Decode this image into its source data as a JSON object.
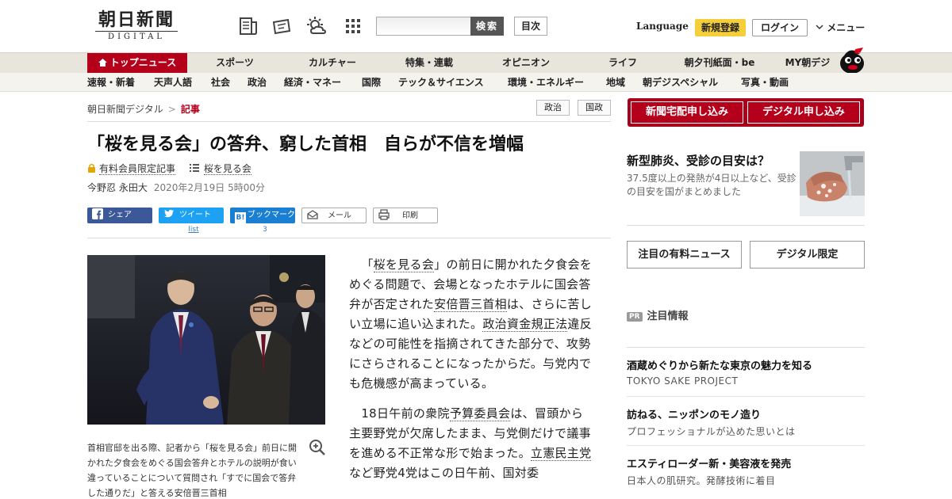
{
  "header": {
    "logo_main": "朝日新聞",
    "logo_sub": "DIGITAL",
    "search_placeholder": "",
    "search_button": "検索",
    "toc_button": "目次",
    "language": "Language",
    "signup": "新規登録",
    "login": "ログイン",
    "menu": "メニュー"
  },
  "nav_primary": [
    "トップニュース",
    "スポーツ",
    "カルチャー",
    "特集・連載",
    "オピニオン",
    "ライフ",
    "朝夕刊紙面・be",
    "MY朝デジ"
  ],
  "nav_secondary": [
    "速報・新着",
    "天声人語",
    "社会",
    "政治",
    "経済・マネー",
    "国際",
    "テック＆サイエンス",
    "環境・エネルギー",
    "地域",
    "朝デジスペシャル",
    "写真・動画"
  ],
  "breadcrumb": {
    "home": "朝日新聞デジタル",
    "sep": ">",
    "current": "記事"
  },
  "tags": [
    "政治",
    "国政"
  ],
  "article": {
    "headline": "「桜を見る会」の答弁、窮した首相　自らが不信を増幅",
    "paid_label": "有料会員限定記事",
    "series_label": "桜を見る会",
    "authors": "今野忍 永田大",
    "date": "2020年2月19日 5時00分",
    "share": {
      "facebook": "シェア",
      "twitter": "ツイート",
      "twitter_sub": "list",
      "hatena": "ブックマーク",
      "hatena_count": "3",
      "mail": "メール",
      "print": "印刷"
    },
    "caption": "首相官邸を出る際、記者から「桜を見る会」前日に開かれた夕食会をめぐる国会答弁とホテルの説明が食い違っていることについて質問され「すでに国会で答弁した通りだ」と答える安倍晋三首相",
    "p1_a": "「",
    "p1_link1": "桜を見る会",
    "p1_b": "」の前日に開かれた夕食会をめぐる問題で、会場となったホテルに国会答弁が否定された",
    "p1_link2": "安倍晋三首相",
    "p1_c": "は、さらに苦しい立場に追い込まれた。",
    "p1_link3": "政治資金規正法",
    "p1_d": "違反などの可能性を指摘されてきた部分で、攻勢にさらされることになったからだ。与党内でも危機感が高まっている。",
    "p2_a": "18日午前の衆院",
    "p2_link1": "予算委員会",
    "p2_b": "は、冒頭から主要野党が欠席したまま、与党側だけで議事を進める不正常な形で始まった。",
    "p2_link2": "立憲民主党",
    "p2_c": "など野党4党はこの日午前、国対委"
  },
  "sidebar": {
    "subscribe_paper": "新聞宅配申し込み",
    "subscribe_digital": "デジタル申し込み",
    "ad_title": "新型肺炎、受診の目安は？",
    "ad_text": "37.5度以上の発熱が4日以上など、受診の目安を国がまとめました",
    "btn_paid_news": "注目の有料ニュース",
    "btn_digital_only": "デジタル限定",
    "pr_badge": "PR",
    "pr_label": "注目情報",
    "promos": [
      {
        "title": "酒蔵めぐりから新たな東京の魅力を知る",
        "sub": "TOKYO SAKE PROJECT"
      },
      {
        "title": "訪ねる、ニッポンのモノ造り",
        "sub": "プロフェッショナルが込めた思いとは"
      },
      {
        "title": "エスティローダー新・美容液を発売",
        "sub": "日本人の肌研究。発酵技術に着目"
      }
    ]
  },
  "colors": {
    "brand_red": "#b5001b",
    "signup_yellow": "#f5cf3a",
    "facebook": "#3b5998",
    "twitter": "#1da1f2",
    "hatena": "#1a7fd1"
  }
}
